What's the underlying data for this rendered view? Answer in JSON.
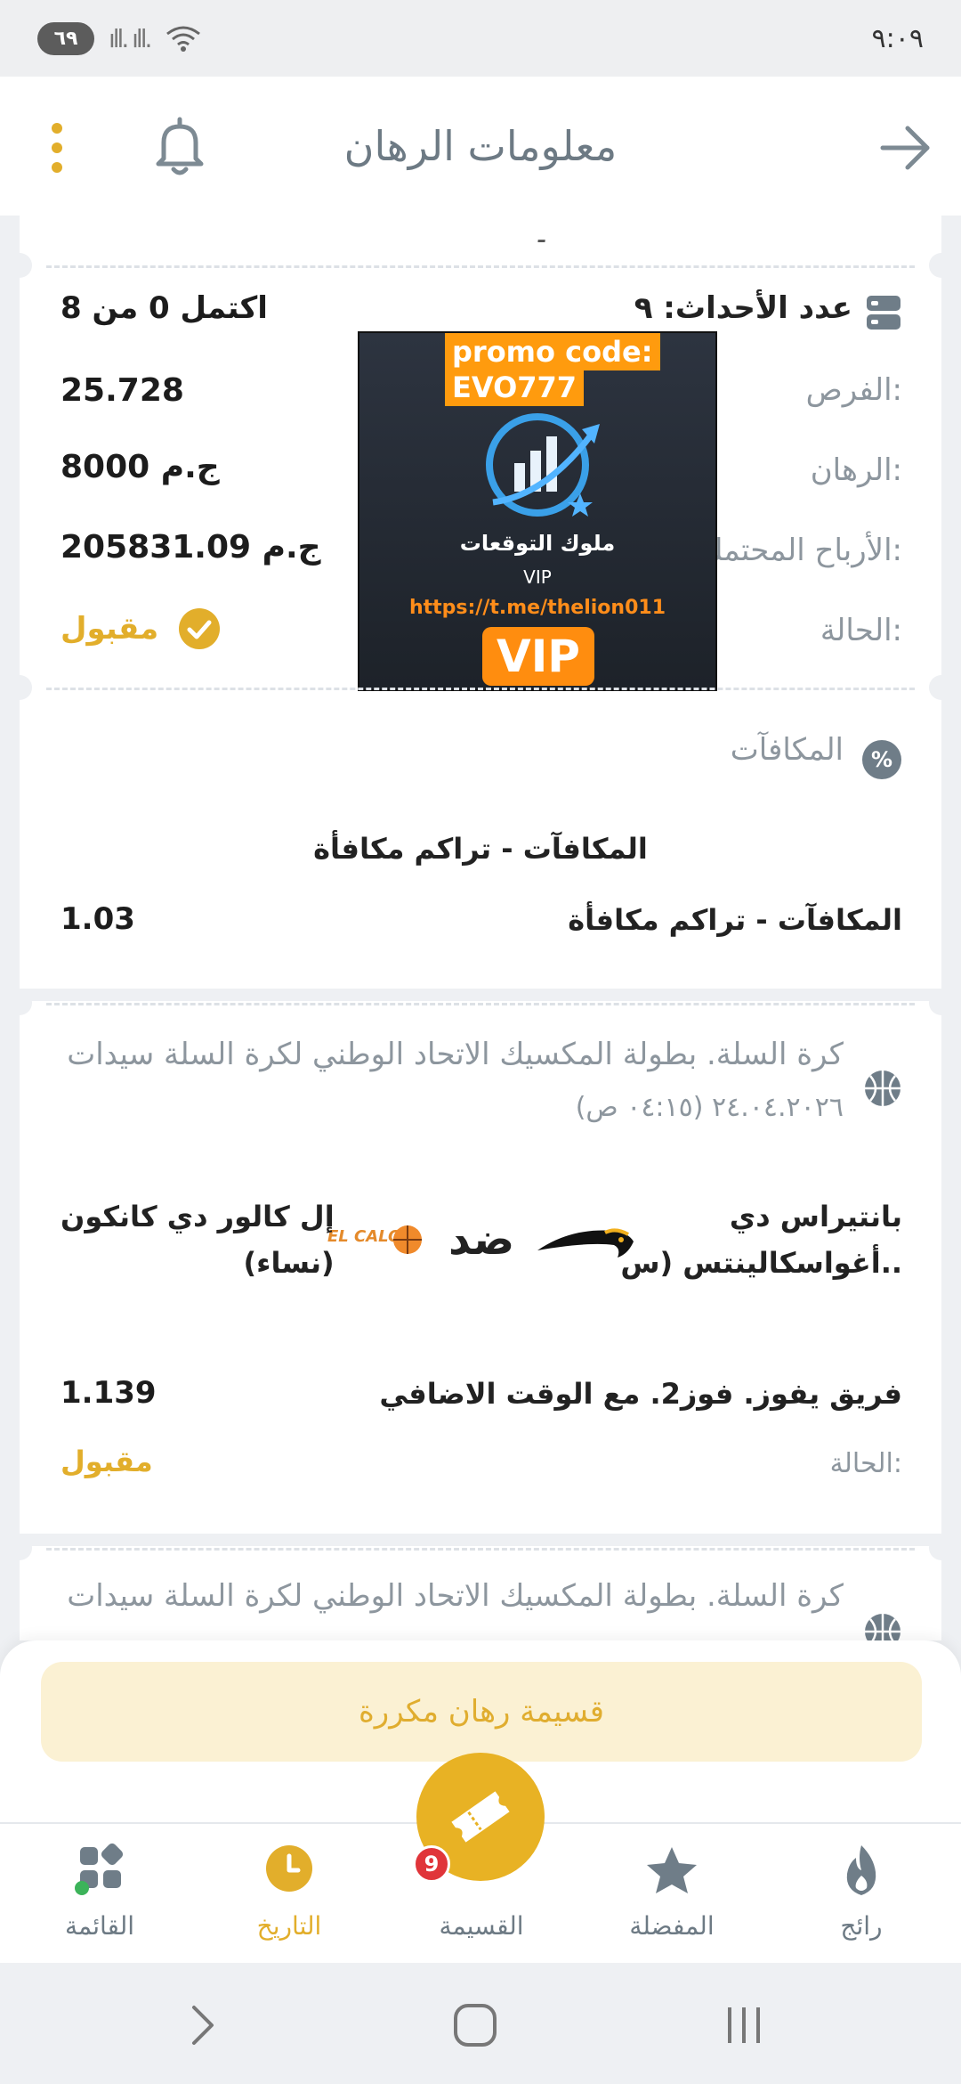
{
  "status_bar": {
    "battery": "٦٩",
    "signal": "ıll. ıll.",
    "wifi_sub": "5",
    "time": "٩:٠٩"
  },
  "header": {
    "title": "معلومات الرهان"
  },
  "summary": {
    "top_fragment": "۔",
    "events_label": "عدد الأحداث: ٩",
    "completed": "اكتمل 0 من 8",
    "odds_label": "الفرص:",
    "odds_value": "25.728",
    "stake_label": "الرهان:",
    "stake_value": "8000 ج.م",
    "potential_label": "الأرباح المحتملة:",
    "potential_value": "205831.09 ج.م",
    "status_label": "الحالة:",
    "status_value": "مقبول",
    "accent_color": "#e2ae2b"
  },
  "promo": {
    "line1": "promo code:",
    "line2": "EVO777",
    "arabic": "ملوك التوقعات",
    "vip_small": "VIP",
    "link": "https://t.me/thelion011",
    "vip_big": "VIP"
  },
  "bonus": {
    "section_title": "المكافآت",
    "center_label": "المكافآت - تراكم مكافأة",
    "row_label": "المكافآت - تراكم مكافأة",
    "row_value": "1.03"
  },
  "event1": {
    "league": "كرة السلة. بطولة المكسيك الاتحاد الوطني لكرة السلة سيدات",
    "datetime": "٢٤.٠٤.٢٠٢٦ (٠٤:١٥ ص)",
    "team_home_line1": "بانتيراس دي",
    "team_home_line2": "أغواسكالينتس (س..",
    "vs": "ضد",
    "team_away_line1": "إل كالور دي كانكون",
    "team_away_line2": "(نساء)",
    "away_logo_text": "EL CALOR",
    "selection": "فريق يفوز. فوز2. مع الوقت الاضافي",
    "odds": "1.139",
    "status_label": "الحالة:",
    "status_value": "مقبول"
  },
  "event2": {
    "league": "كرة السلة. بطولة المكسيك الاتحاد الوطني لكرة السلة سيدات"
  },
  "repeat_button": "قسيمة رهان مكررة",
  "tabs": {
    "trending": "رائج",
    "favorites": "المفضلة",
    "slip": "القسيمة",
    "slip_count": "9",
    "history": "التاريخ",
    "menu": "القائمة"
  }
}
